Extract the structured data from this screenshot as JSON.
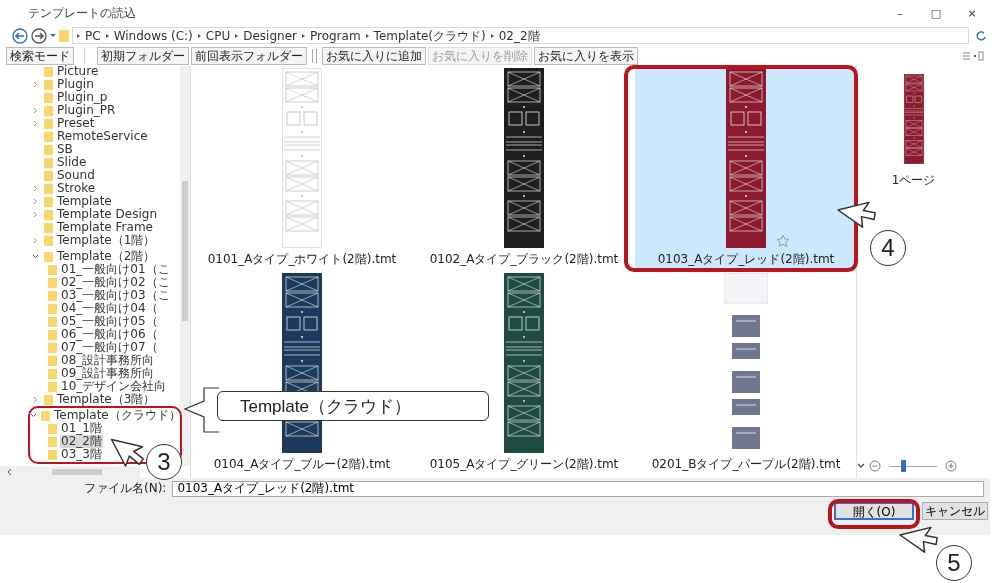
{
  "window": {
    "title": "テンプレートの読込",
    "controls": [
      "–",
      "□",
      "×"
    ]
  },
  "address": {
    "path": [
      "PC",
      "Windows (C:)",
      "CPU",
      "Designer",
      "Program",
      "Template(クラウド)",
      "02_2階"
    ]
  },
  "toolbar": [
    {
      "label": "検索モード",
      "disabled": false
    },
    {
      "label": "初期フォルダー",
      "disabled": false
    },
    {
      "label": "前回表示フォルダー",
      "disabled": false
    },
    {
      "label": "お気に入りに追加",
      "disabled": false
    },
    {
      "label": "お気に入りを削除",
      "disabled": true
    },
    {
      "label": "お気に入りを表示",
      "disabled": false
    }
  ],
  "tree": [
    {
      "label": "Picture",
      "expandable": false,
      "selected": false
    },
    {
      "label": "Plugin",
      "expandable": true,
      "expanded": false,
      "selected": false
    },
    {
      "label": "Plugin_p",
      "expandable": false,
      "selected": false
    },
    {
      "label": "Plugin_PR",
      "expandable": true,
      "expanded": false,
      "selected": false
    },
    {
      "label": "Preset",
      "expandable": true,
      "expanded": false,
      "selected": false
    },
    {
      "label": "RemoteService",
      "expandable": false,
      "selected": false
    },
    {
      "label": "SB",
      "expandable": false,
      "selected": false
    },
    {
      "label": "Slide",
      "expandable": false,
      "selected": false
    },
    {
      "label": "Sound",
      "expandable": false,
      "selected": false
    },
    {
      "label": "Stroke",
      "expandable": true,
      "expanded": false,
      "selected": false
    },
    {
      "label": "Template",
      "expandable": true,
      "expanded": false,
      "selected": false
    },
    {
      "label": "Template Design",
      "expandable": true,
      "expanded": false,
      "selected": false
    },
    {
      "label": "Template Frame",
      "expandable": false,
      "selected": false
    },
    {
      "label": "Template（1階）",
      "expandable": true,
      "expanded": false,
      "selected": false
    },
    {
      "label": "Template（2階）",
      "expandable": true,
      "expanded": true,
      "selected": false,
      "children": [
        {
          "label": "01_一般向け01（こ",
          "expandable": false,
          "selected": false
        },
        {
          "label": "02_一般向け02（こ",
          "expandable": false,
          "selected": false
        },
        {
          "label": "03_一般向け03（こ",
          "expandable": false,
          "selected": false
        },
        {
          "label": "04_一般向け04（",
          "expandable": false,
          "selected": false
        },
        {
          "label": "05_一般向け05（",
          "expandable": false,
          "selected": false
        },
        {
          "label": "06_一般向け06（",
          "expandable": false,
          "selected": false
        },
        {
          "label": "07_一般向け07（",
          "expandable": false,
          "selected": false
        },
        {
          "label": "08_設計事務所向",
          "expandable": false,
          "selected": false
        },
        {
          "label": "09_設計事務所向",
          "expandable": false,
          "selected": false
        },
        {
          "label": "10_デザイン会社向",
          "expandable": false,
          "selected": false
        }
      ]
    },
    {
      "label": "Template（3階）",
      "expandable": true,
      "expanded": false,
      "selected": false
    },
    {
      "label": "Template（クラウド）",
      "expandable": true,
      "expanded": true,
      "selected": false,
      "children": [
        {
          "label": "01_1階",
          "expandable": false,
          "selected": false
        },
        {
          "label": "02_2階",
          "expandable": false,
          "selected": true
        },
        {
          "label": "03_3階",
          "expandable": false,
          "selected": false
        }
      ]
    }
  ],
  "files": [
    {
      "name": "0101_Aタイプ_ホワイト(2階).tmt",
      "kind": "strip",
      "color": "#ffffff",
      "selected": false,
      "favorite": false
    },
    {
      "name": "0102_Aタイプ_ブラック(2階).tmt",
      "kind": "strip",
      "color": "#1e1e1e",
      "selected": false,
      "favorite": false
    },
    {
      "name": "0103_Aタイプ_レッド(2階).tmt",
      "kind": "strip",
      "color": "#8a1a2c",
      "selected": true,
      "favorite": true
    },
    {
      "name": "0104_Aタイプ_ブルー(2階).tmt",
      "kind": "strip",
      "color": "#1c3a5e",
      "selected": false,
      "favorite": false
    },
    {
      "name": "0105_Aタイプ_グリーン(2階).tmt",
      "kind": "strip",
      "color": "#1d4b3f",
      "selected": false,
      "favorite": false
    },
    {
      "name": "0201_Bタイプ_パープル(2階).tmt",
      "kind": "panels",
      "color": "#6e7690",
      "selected": false,
      "favorite": false
    }
  ],
  "preview": {
    "page_label": "1ページ",
    "color": "#8a1a2c",
    "zoom": {
      "level": 0.3
    }
  },
  "filename": {
    "label": "ファイル名(N):",
    "value": "0103_Aタイプ_レッド(2階).tmt"
  },
  "buttons": [
    {
      "label": "開く(O)",
      "default": true
    },
    {
      "label": "キャンセル",
      "default": false
    }
  ],
  "annotations": {
    "callout": "Template（クラウド）",
    "steps": [
      "3",
      "4",
      "5"
    ]
  }
}
